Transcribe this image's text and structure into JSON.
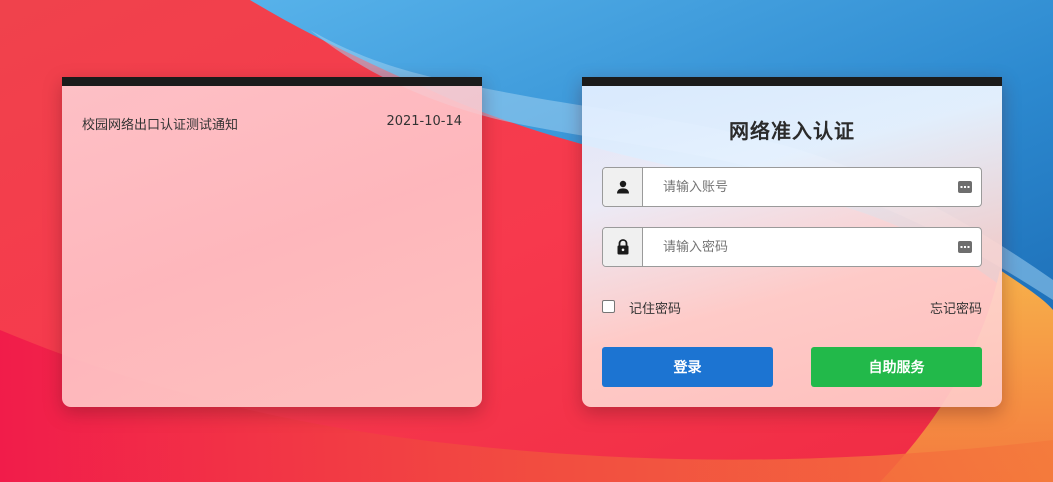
{
  "notice": {
    "items": [
      {
        "title": "校园网络出口认证测试通知",
        "date": "2021-10-14"
      }
    ]
  },
  "login": {
    "title": "网络准入认证",
    "username": {
      "placeholder": "请输入账号",
      "icon": "user-icon"
    },
    "password": {
      "placeholder": "请输入密码",
      "icon": "lock-icon"
    },
    "remember_label": "记住密码",
    "forgot_label": "忘记密码",
    "login_button": "登录",
    "self_service_button": "自助服务"
  },
  "colors": {
    "login_button": "#1c74d2",
    "self_service_button": "#22b94a",
    "panel_topbar": "#1b1b1b"
  }
}
